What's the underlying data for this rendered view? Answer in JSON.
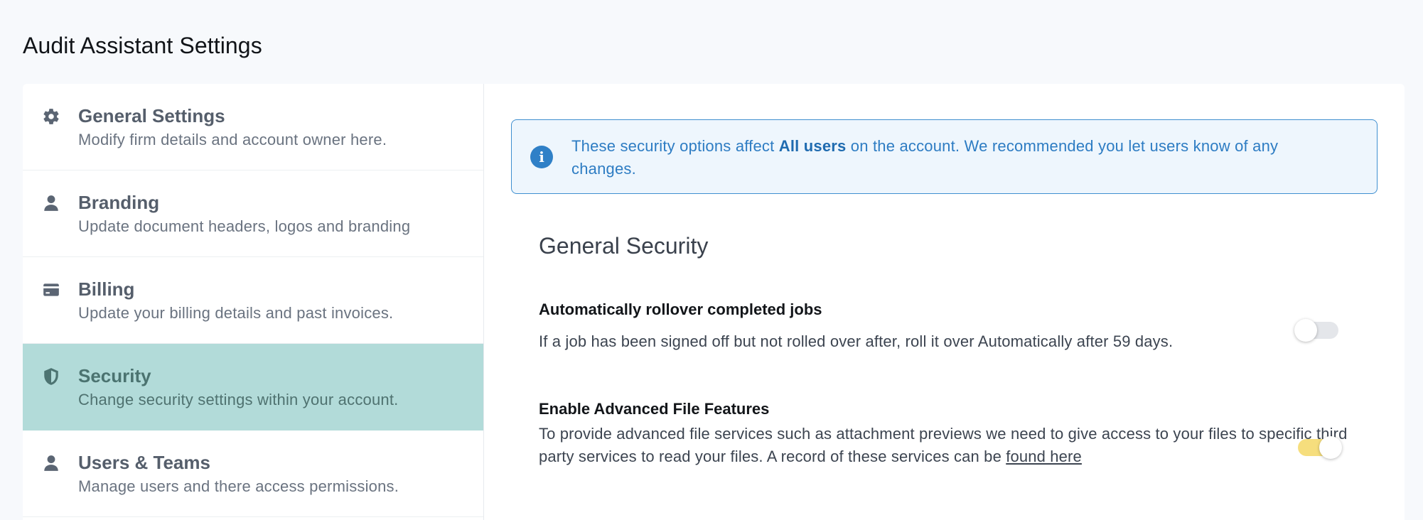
{
  "page": {
    "title": "Audit Assistant Settings"
  },
  "sidebar": {
    "items": [
      {
        "icon": "gear-icon",
        "title": "General Settings",
        "description": "Modify firm details and account owner here.",
        "active": false
      },
      {
        "icon": "user-icon",
        "title": "Branding",
        "description": "Update document headers, logos and branding",
        "active": false
      },
      {
        "icon": "credit-card-icon",
        "title": "Billing",
        "description": "Update your billing details and past invoices.",
        "active": false
      },
      {
        "icon": "shield-icon",
        "title": "Security",
        "description": "Change security settings within your account.",
        "active": true
      },
      {
        "icon": "user-icon",
        "title": "Users & Teams",
        "description": "Manage users and there access permissions.",
        "active": false
      }
    ]
  },
  "banner": {
    "icon": "info-icon",
    "text_before": "These security options affect ",
    "text_bold": "All users",
    "text_after": " on the account. We recommended you let users know of any changes."
  },
  "security": {
    "section_title": "General Security",
    "settings": [
      {
        "title": "Automatically rollover completed jobs",
        "description": "If a job has been signed off but not rolled over after, roll it over Automatically after 59 days.",
        "enabled": false
      },
      {
        "title": "Enable Advanced File Features",
        "description": "To provide advanced file services such as attachment previews we need to give access to your files to specific third party services to read your files. A record of these services can be ",
        "link_text": "found here",
        "enabled": true
      }
    ]
  },
  "colors": {
    "active_nav_bg": "#b2dbd9",
    "banner_border": "#3f8fd0",
    "toggle_on": "#f6de7d",
    "toggle_off": "#e4e6ea"
  }
}
